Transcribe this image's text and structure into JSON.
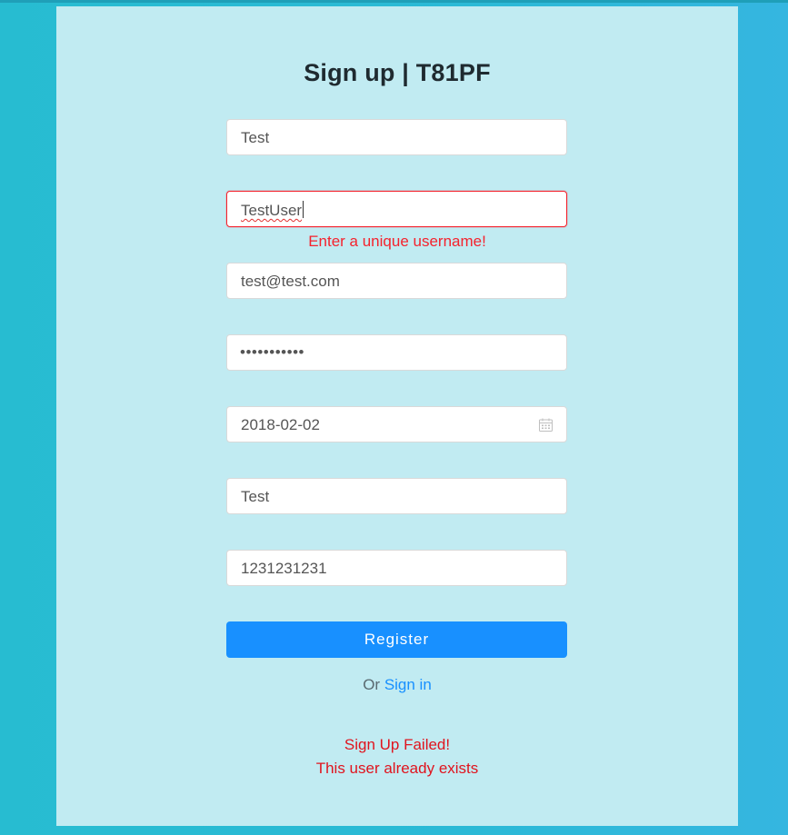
{
  "page": {
    "title": "Sign up | T81PF"
  },
  "form": {
    "first_name": "Test",
    "username": "TestUser",
    "username_error": "Enter a unique username!",
    "email": "test@test.com",
    "password_mask": "•••••••••••",
    "birth_date": "2018-02-02",
    "last_name": "Test",
    "phone": "1231231231",
    "register_label": "Register"
  },
  "signin": {
    "prefix": "Or",
    "link_label": "Sign in"
  },
  "status": {
    "headline": "Sign Up Failed!",
    "detail": "This user already exists"
  },
  "colors": {
    "page_background": "#2bb9d6",
    "card_background": "#c1ebf2",
    "primary": "#1890ff",
    "error": "#f5222d"
  },
  "icons": {
    "date_field": "calendar-icon"
  }
}
